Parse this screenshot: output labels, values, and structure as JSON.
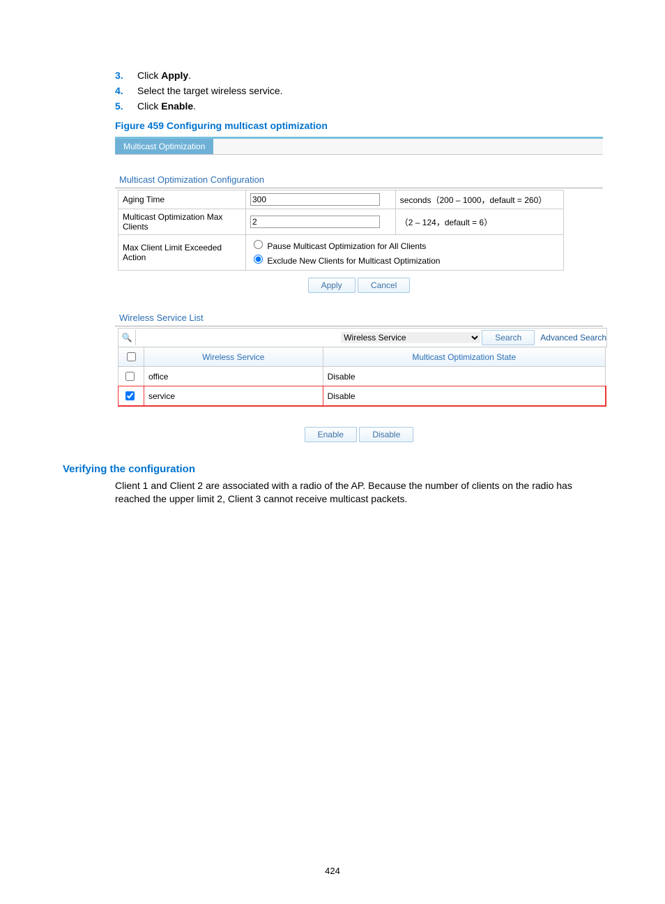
{
  "steps": {
    "s3": {
      "num": "3.",
      "pre": "Click ",
      "bold": "Apply",
      "post": "."
    },
    "s4": {
      "num": "4.",
      "text": "Select the target wireless service."
    },
    "s5": {
      "num": "5.",
      "pre": "Click ",
      "bold": "Enable",
      "post": "."
    }
  },
  "figure_caption": "Figure 459 Configuring multicast optimization",
  "tab": "Multicast Optimization",
  "config_title": "Multicast Optimization Configuration",
  "form": {
    "aging_label": "Aging Time",
    "aging_value": "300",
    "aging_hint": "seconds（200 – 1000，default = 260）",
    "max_label": "Multicast Optimization Max Clients",
    "max_value": "2",
    "max_hint": "（2 – 124，default = 6）",
    "action_label": "Max Client Limit Exceeded Action",
    "radio1": "Pause Multicast Optimization for All Clients",
    "radio2": "Exclude New Clients for Multicast Optimization"
  },
  "buttons": {
    "apply": "Apply",
    "cancel": "Cancel",
    "enable": "Enable",
    "disable": "Disable",
    "search": "Search"
  },
  "wireless_title": "Wireless Service List",
  "search": {
    "dropdown": "Wireless Service",
    "advanced": "Advanced Search"
  },
  "list": {
    "col1": "Wireless Service",
    "col2": "Multicast Optimization State",
    "rows": [
      {
        "name": "office",
        "state": "Disable",
        "checked": false
      },
      {
        "name": "service",
        "state": "Disable",
        "checked": true
      }
    ]
  },
  "verify_heading": "Verifying the configuration",
  "verify_body": "Client 1 and Client 2 are associated with a radio of the AP. Because the number of clients on the radio has reached the upper limit 2, Client 3 cannot receive multicast packets.",
  "page_num": "424"
}
